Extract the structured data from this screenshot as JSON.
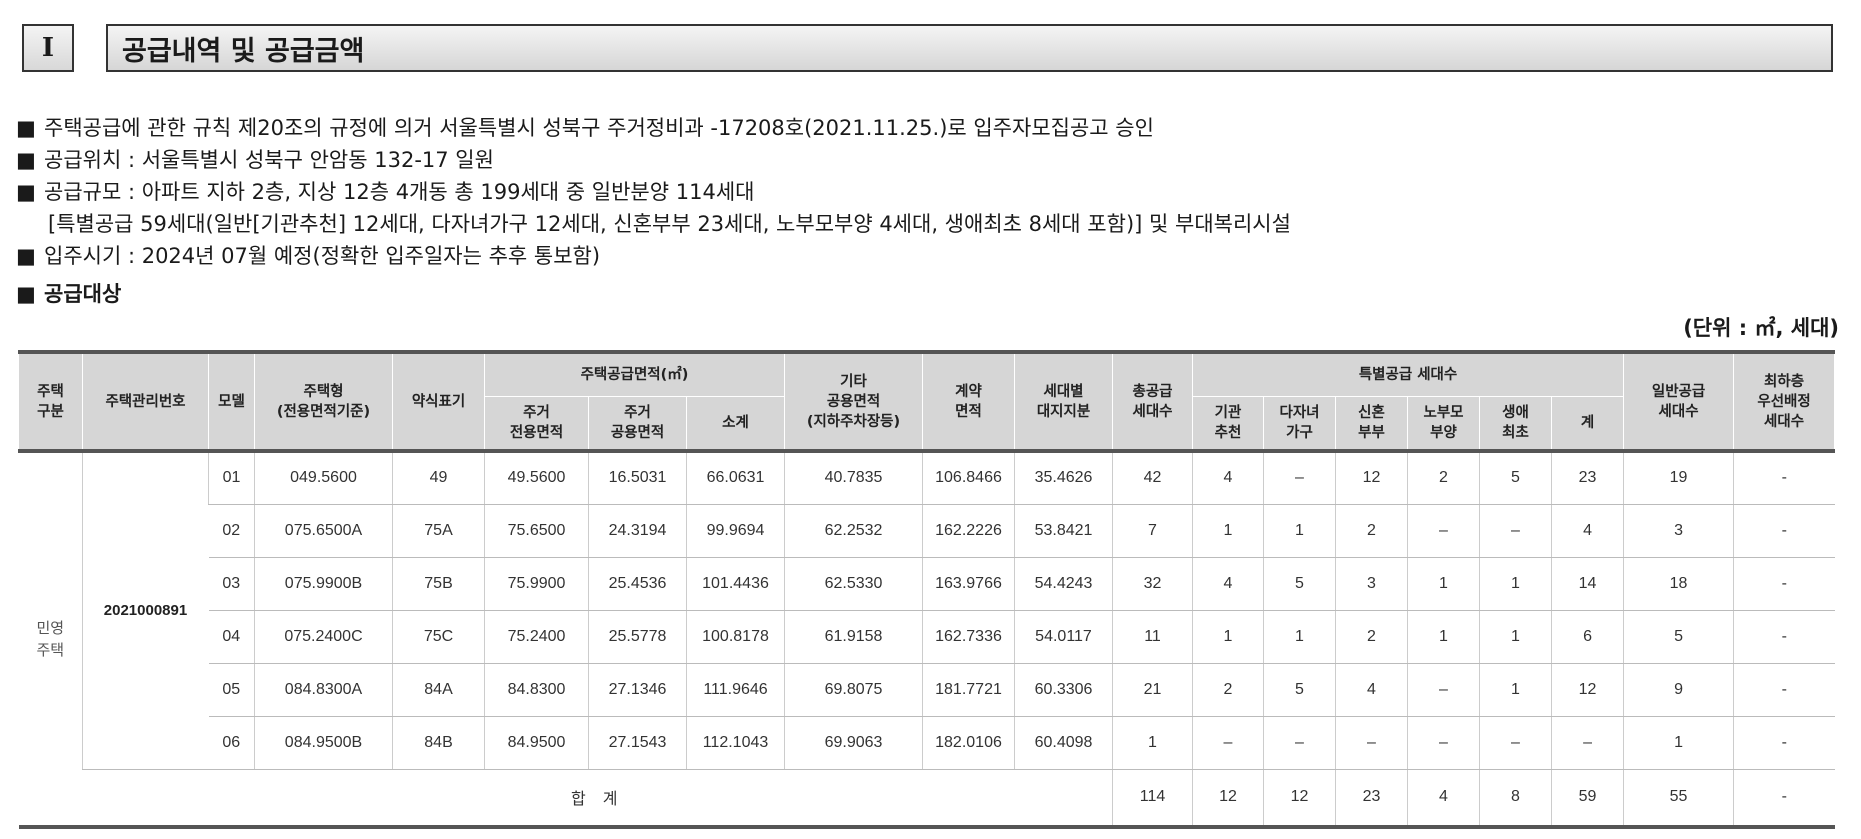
{
  "section": {
    "number": "I",
    "title": "공급내역 및 공급금액"
  },
  "bullets": [
    "주택공급에 관한 규칙 제20조의 규정에 의거 서울특별시 성북구 주거정비과 -17208호(2021.11.25.)로 입주자모집공고 승인",
    "공급위치 : 서울특별시 성북구 안암동 132-17 일원",
    "공급규모 : 아파트 지하 2층, 지상 12층 4개동 총 199세대 중 일반분양 114세대",
    "[특별공급 59세대(일반[기관추천] 12세대, 다자녀가구 12세대, 신혼부부 23세대, 노부모부양 4세대, 생애최초 8세대 포함)] 및 부대복리시설",
    "입주시기 : 2024년 07월 예정(정확한 입주일자는 추후 통보함)",
    "공급대상"
  ],
  "bullet_mark": "■",
  "unit_note": "(단위 : ㎡, 세대)",
  "table": {
    "headers": {
      "house_category": "주택\n구분",
      "mgmt_no": "주택관리번호",
      "model": "모델",
      "house_type": "주택형\n(전용면적기준)",
      "abbrev": "약식표기",
      "supply_area": "주택공급면적(㎡)",
      "exclusive": "주거\n전용면적",
      "common": "주거\n공용면적",
      "subtotal": "소계",
      "other_common": "기타\n공용면적\n(지하주차장등)",
      "contract_area": "계약\n면적",
      "land_share": "세대별\n대지지분",
      "total_supply": "총공급\n세대수",
      "special": "특별공급 세대수",
      "agency": "기관\n추천",
      "multi_child": "다자녀\n가구",
      "newlywed": "신혼\n부부",
      "elderly": "노부모\n부양",
      "first_time": "생애\n최초",
      "special_total": "계",
      "general": "일반공급\n세대수",
      "lowest_floor": "최하층\n우선배정\n세대수"
    },
    "house_category_value": "민영\n주택",
    "mgmt_no_value": "2021000891",
    "rows": [
      {
        "model": "01",
        "type": "049.5600",
        "abbr": "49",
        "exclusive": "49.5600",
        "common": "16.5031",
        "subtotal": "66.0631",
        "other": "40.7835",
        "contract": "106.8466",
        "land": "35.4626",
        "total": "42",
        "agency": "4",
        "multi": "–",
        "newlywed": "12",
        "elderly": "2",
        "first": "5",
        "sp_total": "23",
        "general": "19",
        "lowest": "-"
      },
      {
        "model": "02",
        "type": "075.6500A",
        "abbr": "75A",
        "exclusive": "75.6500",
        "common": "24.3194",
        "subtotal": "99.9694",
        "other": "62.2532",
        "contract": "162.2226",
        "land": "53.8421",
        "total": "7",
        "agency": "1",
        "multi": "1",
        "newlywed": "2",
        "elderly": "–",
        "first": "–",
        "sp_total": "4",
        "general": "3",
        "lowest": "-"
      },
      {
        "model": "03",
        "type": "075.9900B",
        "abbr": "75B",
        "exclusive": "75.9900",
        "common": "25.4536",
        "subtotal": "101.4436",
        "other": "62.5330",
        "contract": "163.9766",
        "land": "54.4243",
        "total": "32",
        "agency": "4",
        "multi": "5",
        "newlywed": "3",
        "elderly": "1",
        "first": "1",
        "sp_total": "14",
        "general": "18",
        "lowest": "-"
      },
      {
        "model": "04",
        "type": "075.2400C",
        "abbr": "75C",
        "exclusive": "75.2400",
        "common": "25.5778",
        "subtotal": "100.8178",
        "other": "61.9158",
        "contract": "162.7336",
        "land": "54.0117",
        "total": "11",
        "agency": "1",
        "multi": "1",
        "newlywed": "2",
        "elderly": "1",
        "first": "1",
        "sp_total": "6",
        "general": "5",
        "lowest": "-"
      },
      {
        "model": "05",
        "type": "084.8300A",
        "abbr": "84A",
        "exclusive": "84.8300",
        "common": "27.1346",
        "subtotal": "111.9646",
        "other": "69.8075",
        "contract": "181.7721",
        "land": "60.3306",
        "total": "21",
        "agency": "2",
        "multi": "5",
        "newlywed": "4",
        "elderly": "–",
        "first": "1",
        "sp_total": "12",
        "general": "9",
        "lowest": "-"
      },
      {
        "model": "06",
        "type": "084.9500B",
        "abbr": "84B",
        "exclusive": "84.9500",
        "common": "27.1543",
        "subtotal": "112.1043",
        "other": "69.9063",
        "contract": "182.0106",
        "land": "60.4098",
        "total": "1",
        "agency": "–",
        "multi": "–",
        "newlywed": "–",
        "elderly": "–",
        "first": "–",
        "sp_total": "–",
        "general": "1",
        "lowest": "-"
      }
    ],
    "total_row": {
      "label": "합 계",
      "total": "114",
      "agency": "12",
      "multi": "12",
      "newlywed": "23",
      "elderly": "4",
      "first": "8",
      "sp_total": "59",
      "general": "55",
      "lowest": "-"
    }
  }
}
